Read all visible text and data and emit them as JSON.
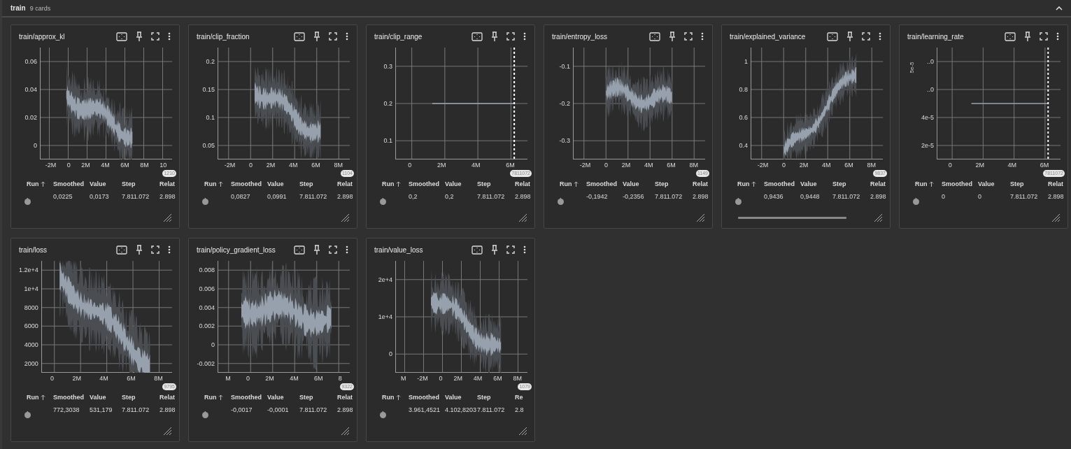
{
  "section": {
    "title": "train",
    "count": "9 cards",
    "expanded": true
  },
  "cards": [
    {
      "title": "train/approx_kl",
      "kind": "noisy",
      "yticks": [
        "0.06",
        "0.04",
        "0.02",
        "0"
      ],
      "xticks": [
        "-2M",
        "0",
        "2M",
        "4M",
        "6M",
        "8M",
        "10"
      ],
      "step_badge": "1210",
      "columns": [
        "Run",
        "Smoothed",
        "Value",
        "Step",
        "Relat"
      ],
      "row": [
        ".",
        "0,0225",
        "0,0173",
        "7.811.072",
        "2.898"
      ],
      "horizontal_scrollbar": false
    },
    {
      "title": "train/clip_fraction",
      "kind": "noisy",
      "yticks": [
        "0.2",
        "0.15",
        "0.1",
        "0.05"
      ],
      "xticks": [
        "-2M",
        "0",
        "2M",
        "4M",
        "6M",
        "8M"
      ],
      "step_badge": "1104",
      "columns": [
        "Run",
        "Smoothed",
        "Value",
        "Step",
        "Relat"
      ],
      "row": [
        ".",
        "0,0827",
        "0,0991",
        "7.811.072",
        "2.898"
      ],
      "horizontal_scrollbar": false
    },
    {
      "title": "train/clip_range",
      "kind": "flat",
      "yticks": [
        "0.3",
        "0.2",
        "0.1"
      ],
      "xticks": [
        "0",
        "2M",
        "4M",
        "6M"
      ],
      "step_badge": "7811072",
      "columns": [
        "Run",
        "Smoothed",
        "Value",
        "Step",
        "Relat"
      ],
      "row": [
        ".",
        "0,2",
        "0,2",
        "7.811.072",
        "2.898"
      ],
      "horizontal_scrollbar": false
    },
    {
      "title": "train/entropy_loss",
      "kind": "noisy",
      "yticks": [
        "-0.1",
        "-0.2",
        "-0.3"
      ],
      "xticks": [
        "-2M",
        "0",
        "2M",
        "4M",
        "6M",
        "8M"
      ],
      "step_badge": "1149",
      "columns": [
        "Run",
        "Smoothed",
        "Value",
        "Step",
        "Relat"
      ],
      "row": [
        ".",
        "-0,1942",
        "-0,2356",
        "7.811.072",
        "2.898"
      ],
      "horizontal_scrollbar": false
    },
    {
      "title": "train/explained_variance",
      "kind": "noisy",
      "yticks": [
        "1",
        "0.8",
        "0.6",
        "0.4"
      ],
      "xticks": [
        "-2M",
        "0",
        "2M",
        "4M",
        "6M",
        "8M"
      ],
      "step_badge": "9837",
      "columns": [
        "Run",
        "Smoothed",
        "Value",
        "Step",
        "Relat"
      ],
      "row": [
        ".",
        "0,9436",
        "0,9448",
        "7.811.072",
        "2.898"
      ],
      "horizontal_scrollbar": true
    },
    {
      "title": "train/learning_rate",
      "kind": "flat",
      "ylabel": "5e-5",
      "yticks": [
        "..0",
        "..0",
        "4e-5",
        "2e-5"
      ],
      "xticks": [
        "0",
        "2M",
        "4M",
        "6M"
      ],
      "step_badge": "7811072",
      "columns": [
        "Run",
        "Smoothed",
        "Value",
        "Step",
        "Relat"
      ],
      "row": [
        ".",
        "0",
        "0",
        "7.811.072",
        "2.898"
      ],
      "horizontal_scrollbar": false
    },
    {
      "title": "train/loss",
      "kind": "noisy",
      "yticks": [
        "1.2e+4",
        "1e+4",
        "8000",
        "6000",
        "4000",
        "2000"
      ],
      "xticks": [
        "0",
        "2M",
        "4M",
        "6M",
        "8M"
      ],
      "step_badge": "9795",
      "columns": [
        "Run",
        "Smoothed",
        "Value",
        "Step",
        "Relat"
      ],
      "row": [
        ".",
        "772,3038",
        "531,179",
        "7.811.072",
        "2.898"
      ],
      "horizontal_scrollbar": false
    },
    {
      "title": "train/policy_gradient_loss",
      "kind": "noisy",
      "yticks": [
        "0.008",
        "0.006",
        "0.004",
        "0.002",
        "0",
        "-0.002"
      ],
      "xticks": [
        "M",
        "0",
        "2M",
        "4M",
        "6M",
        "8"
      ],
      "step_badge": "9322",
      "columns": [
        "Run",
        "Smoothed",
        "Value",
        "Step",
        "Relat"
      ],
      "row": [
        ".",
        "-0,0017",
        "-0,0001",
        "7.811.072",
        "2.898"
      ],
      "horizontal_scrollbar": false
    },
    {
      "title": "train/value_loss",
      "kind": "noisy",
      "yticks": [
        "2e+4",
        "1e+4",
        "0"
      ],
      "xticks": [
        "M",
        "-2M",
        "0",
        "2M",
        "4M",
        "6M",
        "8M"
      ],
      "step_badge": "1079",
      "columns": [
        "Run",
        "Smoothed",
        "Value",
        "Step",
        "Re"
      ],
      "row": [
        ".",
        "3.961,4521",
        "4.102,8203",
        "7.811.072",
        "2.8"
      ],
      "horizontal_scrollbar": false
    }
  ]
}
